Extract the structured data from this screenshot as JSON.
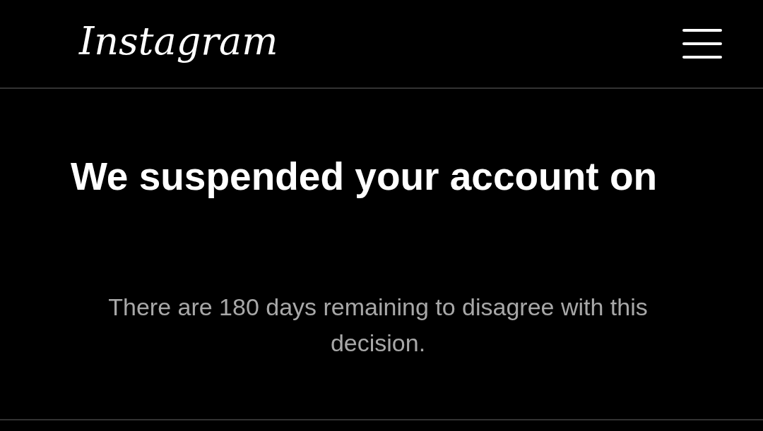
{
  "header": {
    "logo": "Instagram"
  },
  "notice": {
    "title": "We suspended your account on",
    "message": "There are 180 days remaining to disagree with this decision."
  }
}
